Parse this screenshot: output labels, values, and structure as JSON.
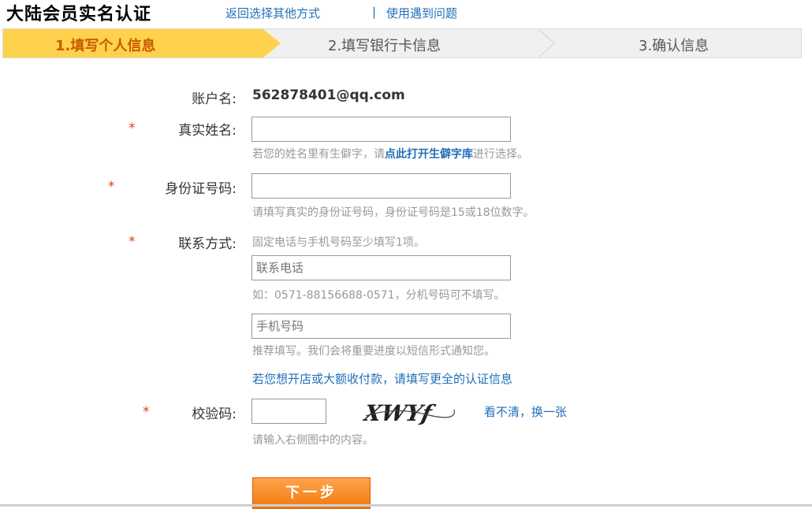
{
  "header": {
    "title": "大陆会员实名认证",
    "link_back": "返回选择其他方式",
    "separator": "|",
    "link_help": "使用遇到问题"
  },
  "steps": [
    {
      "label": "1.填写个人信息",
      "active": true
    },
    {
      "label": "2.填写银行卡信息",
      "active": false
    },
    {
      "label": "3.确认信息",
      "active": false
    }
  ],
  "form": {
    "account": {
      "label": "账户名:",
      "value": "562878401@qq.com"
    },
    "required_mark": "*",
    "real_name": {
      "label": "真实姓名:",
      "value": "",
      "hint_prefix": "若您的姓名里有生僻字，请",
      "hint_link": "点此打开生僻字库",
      "hint_suffix": "进行选择。"
    },
    "id_number": {
      "label": "身份证号码:",
      "value": "",
      "hint": "请填写真实的身份证号码，身份证号码是15或18位数字。"
    },
    "contact": {
      "label": "联系方式:",
      "note": "固定电话与手机号码至少填写1项。",
      "phone_placeholder": "联系电话",
      "phone_hint": "如：0571-88156688-0571，分机号码可不填写。",
      "mobile_placeholder": "手机号码",
      "mobile_hint": "推荐填写。我们会将重要进度以短信形式通知您。"
    },
    "more_info_link": "若您想开店或大额收付款，请填写更全的认证信息",
    "captcha": {
      "label": "校验码:",
      "value": "",
      "image_text": "XWYf",
      "refresh_link": "看不清，换一张",
      "hint": "请输入右侧图中的内容。"
    },
    "submit_label": "下一步"
  },
  "colors": {
    "accent_yellow": "#ffd24d",
    "link_blue": "#1f6fb8",
    "required_red": "#e03c1e",
    "button_orange": "#f27a0f"
  }
}
